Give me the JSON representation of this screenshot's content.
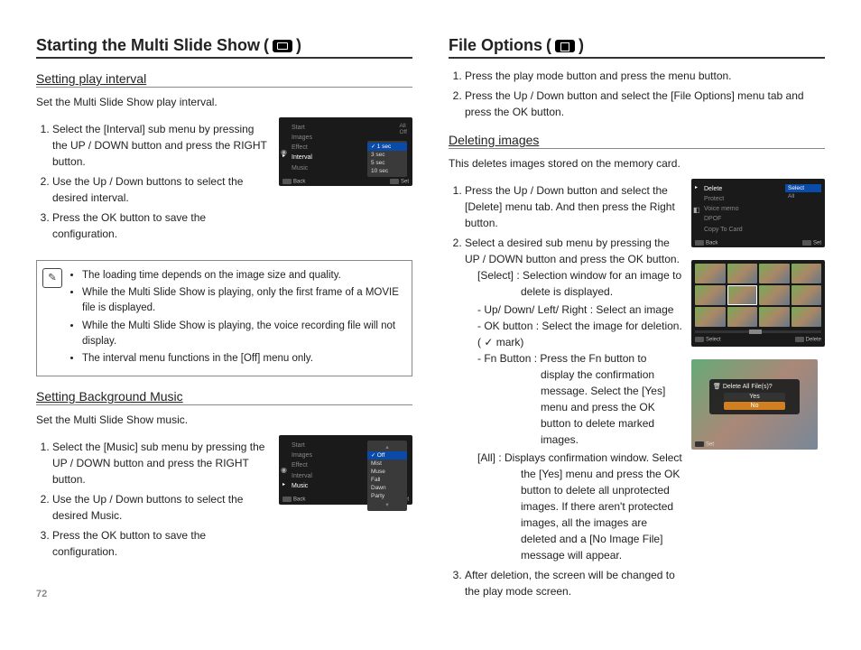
{
  "pageNumber": "72",
  "left": {
    "title": "Starting the Multi Slide Show",
    "section1": {
      "heading": "Setting play interval",
      "intro": "Set the Multi Slide Show play interval.",
      "steps": [
        "Select the [Interval] sub menu by pressing the UP / DOWN button and press the RIGHT button.",
        "Use the Up / Down buttons to select the desired interval.",
        "Press the OK button to save the configuration."
      ],
      "menu": {
        "items": [
          "Start",
          "Images",
          "Effect",
          "Interval",
          "Music"
        ],
        "rightCol": [
          "All",
          "Off"
        ],
        "sub": [
          "1 sec",
          "3 sec",
          "5 sec",
          "10 sec"
        ],
        "back": "Back",
        "set": "Set"
      },
      "notes": [
        "The loading time depends on the image size and quality.",
        "While the Multi Slide Show is playing, only the first frame of a MOVIE file is displayed.",
        "While the Multi Slide Show is playing, the voice recording file will not display.",
        "The interval menu functions in the [Off] menu only."
      ]
    },
    "section2": {
      "heading": "Setting Background Music",
      "intro": "Set the Multi Slide Show music.",
      "steps": [
        "Select the [Music] sub menu by pressing the UP / DOWN button and press the RIGHT button.",
        "Use the Up / Down buttons to select the desired Music.",
        "Press the OK button to save the configuration."
      ],
      "menu": {
        "items": [
          "Start",
          "Images",
          "Effect",
          "Interval",
          "Music"
        ],
        "sub": [
          "Off",
          "Mist",
          "Muse",
          "Fall",
          "Dawn",
          "Party"
        ],
        "back": "Back",
        "set": "Set"
      }
    }
  },
  "right": {
    "title": "File Options",
    "introSteps": [
      "Press the play mode button and press the menu button.",
      "Press the Up / Down button and select the [File Options] menu tab and press the OK button."
    ],
    "section1": {
      "heading": "Deleting images",
      "intro": "This deletes images stored on the memory card.",
      "step1": "Press the Up / Down button and select the [Delete] menu tab. And then press the Right button.",
      "step2": "Select a desired sub menu by pressing the UP / DOWN button and press the OK button.",
      "selectLine": "[Select] : Selection window for an image to delete is displayed.",
      "selectSubs": [
        "- Up/ Down/ Left/ Right : Select an image",
        "- OK button : Select the image for deletion. (  ✓  mark)",
        "- Fn Button : Press the Fn button to display the confirmation message. Select the [Yes] menu and press the OK button to delete marked images."
      ],
      "allLine": "[All] : Displays confirmation window. Select the [Yes] menu and press the OK button to delete all unprotected images. If there aren't protected images, all the images are deleted and a [No Image File] message will appear.",
      "step3": "After deletion, the screen will be changed to the play mode screen.",
      "menu": {
        "items": [
          "Delete",
          "Protect",
          "Voice memo",
          "DPOF",
          "Copy To Card"
        ],
        "sub": [
          "Select",
          "All"
        ],
        "back": "Back",
        "set": "Set"
      },
      "grid": {
        "select": "Select",
        "delete": "Delete"
      },
      "confirm": {
        "title": "Delete All File(s)?",
        "yes": "Yes",
        "no": "No",
        "set": "Set"
      }
    }
  }
}
